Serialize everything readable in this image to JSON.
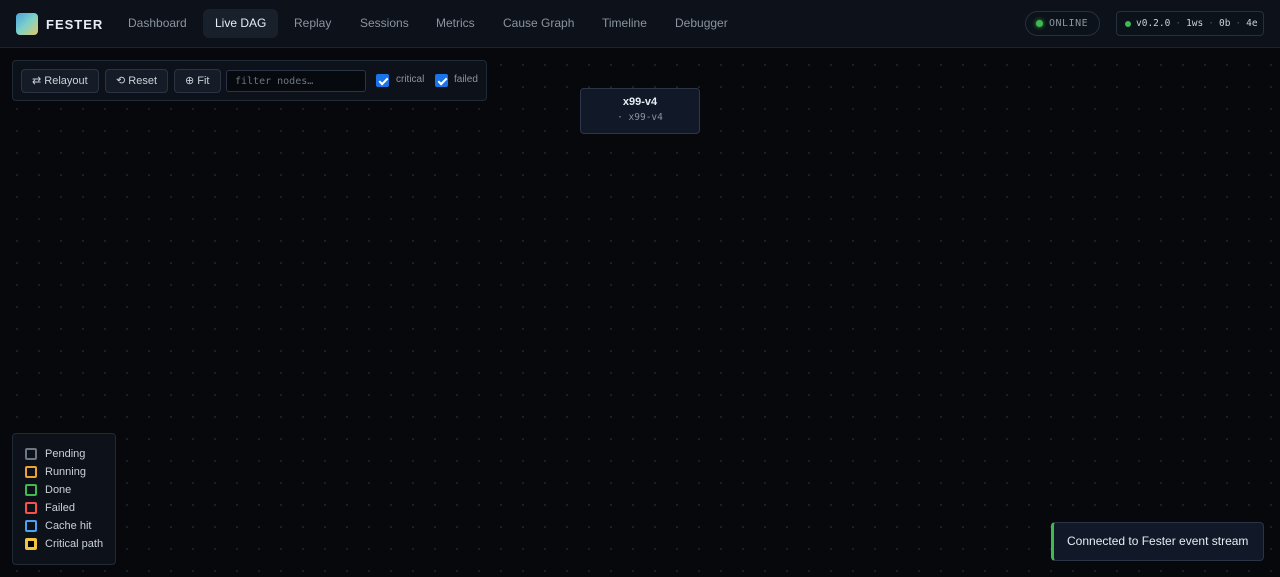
{
  "app": {
    "logo_icon": "fester-logo",
    "name": "FESTER"
  },
  "nav": {
    "items": [
      {
        "label": "Dashboard",
        "active": false
      },
      {
        "label": "Live DAG",
        "active": true
      },
      {
        "label": "Replay",
        "active": false
      },
      {
        "label": "Sessions",
        "active": false
      },
      {
        "label": "Metrics",
        "active": false
      },
      {
        "label": "Cause Graph",
        "active": false
      },
      {
        "label": "Timeline",
        "active": false
      },
      {
        "label": "Debugger",
        "active": false
      }
    ]
  },
  "status": {
    "label": "ONLINE",
    "color": "#3fb950"
  },
  "meta": {
    "version": "v0.2.0",
    "workspaces": "1ws",
    "bytes": "0b",
    "events": "4e",
    "separator": "·"
  },
  "toolbar": {
    "relayout_label": "⇄ Relayout",
    "reset_label": "⟲ Reset",
    "fit_label": "⊕ Fit",
    "filter_placeholder": "filter nodes…",
    "filter_value": "",
    "critical_label": "critical",
    "critical_checked": true,
    "failed_label": "failed",
    "failed_checked": true
  },
  "nodes": [
    {
      "title": "x99-v4",
      "subtitle": "· x99-v4"
    }
  ],
  "legend": {
    "items": [
      {
        "label": "Pending",
        "color": "#6e7681"
      },
      {
        "label": "Running",
        "color": "#f0a030"
      },
      {
        "label": "Done",
        "color": "#3fb950"
      },
      {
        "label": "Failed",
        "color": "#f85149"
      },
      {
        "label": "Cache hit",
        "color": "#4aa3f0"
      },
      {
        "label": "Critical path",
        "color": "#f5c242"
      }
    ]
  },
  "toast": {
    "message": "Connected to Fester event stream",
    "accent": "#3fb950"
  }
}
